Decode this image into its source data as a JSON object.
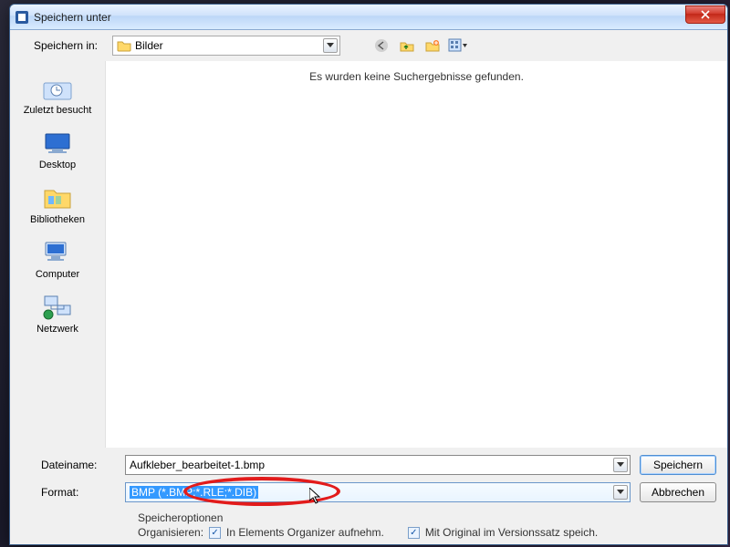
{
  "title": "Speichern unter",
  "look_in_label": "Speichern in:",
  "look_in_value": "Bilder",
  "no_results": "Es wurden keine Suchergebnisse gefunden.",
  "places": [
    {
      "label": "Zuletzt besucht",
      "icon": "recent"
    },
    {
      "label": "Desktop",
      "icon": "desktop"
    },
    {
      "label": "Bibliotheken",
      "icon": "libraries"
    },
    {
      "label": "Computer",
      "icon": "computer"
    },
    {
      "label": "Netzwerk",
      "icon": "network"
    }
  ],
  "filename_label": "Dateiname:",
  "filename_value": "Aufkleber_bearbeitet-1.bmp",
  "format_label": "Format:",
  "format_value": "BMP (*.BMP;*.RLE;*.DIB)",
  "save_button": "Speichern",
  "cancel_button": "Abbrechen",
  "options_title": "Speicheroptionen",
  "organize_label": "Organisieren:",
  "opt1_label": "In Elements Organizer aufnehm.",
  "opt2_label": "Mit Original im Versionssatz speich.",
  "colors": {
    "accent": "#3399ff",
    "highlight_red": "#e21b1b"
  }
}
